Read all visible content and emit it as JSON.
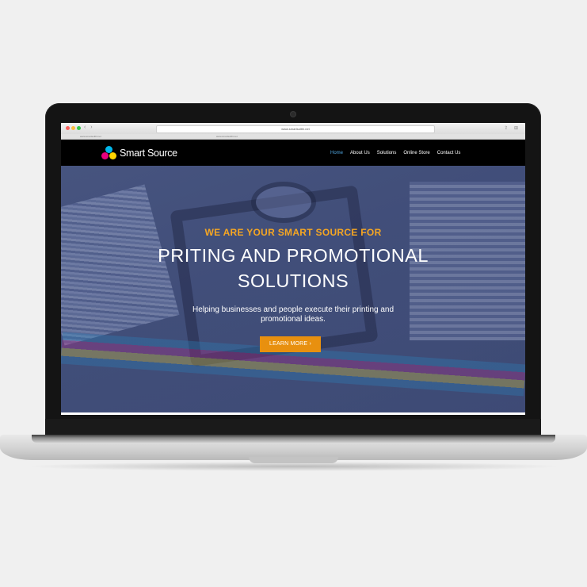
{
  "browser": {
    "url": "www.smartsolthi.net",
    "tabs": [
      "www.smartsolthi.net",
      "www.smartsolthi.net"
    ]
  },
  "site": {
    "logo_text": "Smart Source",
    "nav": [
      {
        "label": "Home",
        "active": true
      },
      {
        "label": "About Us"
      },
      {
        "label": "Solutions"
      },
      {
        "label": "Online Store"
      },
      {
        "label": "Contact Us"
      }
    ]
  },
  "hero": {
    "kicker": "WE ARE YOUR SMART SOURCE FOR",
    "title_line1": "PRITING AND PROMOTIONAL",
    "title_line2": "SOLUTIONS",
    "subtitle_line1": "Helping businesses and people execute their printing and",
    "subtitle_line2": "promotional ideas.",
    "cta_label": "LEARN MORE ›"
  },
  "colors": {
    "accent": "#f5a623",
    "cta": "#e8900f",
    "nav_active": "#4fa6e0",
    "header_bg": "#000000",
    "hero_overlay": "#3e4b76"
  }
}
